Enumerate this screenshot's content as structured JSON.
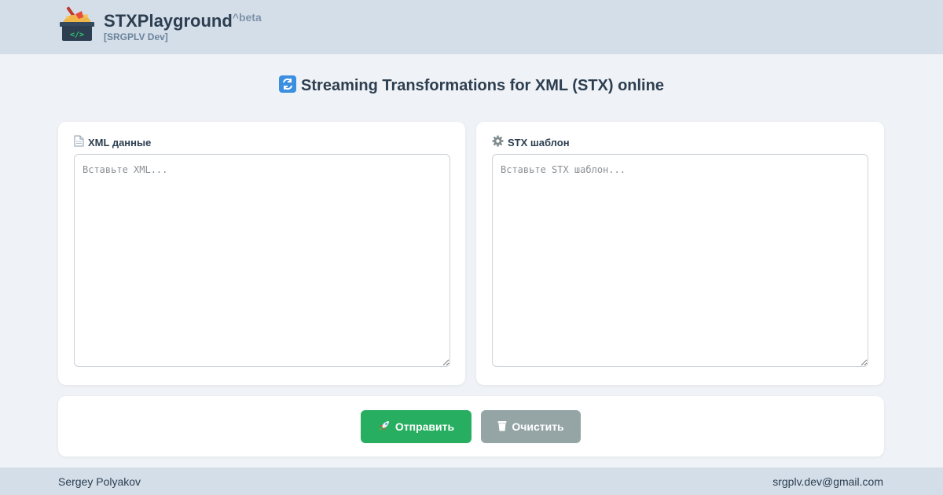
{
  "header": {
    "app_title": "STXPlayground",
    "beta_label": "^beta",
    "subtitle": "[SRGPLV Dev]",
    "logo_icon": "sandbox-code-icon"
  },
  "main": {
    "title": "Streaming Transformations for XML (STX) online",
    "title_icon": "refresh-arrows-icon",
    "xml_panel": {
      "label": "XML данные",
      "icon": "document-icon",
      "value": "",
      "placeholder": "Вставьте XML..."
    },
    "stx_panel": {
      "label": "STX шаблон",
      "icon": "gear-icon",
      "value": "",
      "placeholder": "Вставьте STX шаблон..."
    },
    "actions": {
      "send_label": "Отправить",
      "send_icon": "rocket-icon",
      "clear_label": "Очистить",
      "clear_icon": "trash-icon"
    }
  },
  "footer": {
    "author": "Sergey Polyakov",
    "email": "srgplv.dev@gmail.com"
  },
  "colors": {
    "header_bg": "#d3dee9",
    "page_bg": "#eff2f6",
    "send_button": "#27ae60",
    "clear_button": "#95a5a6",
    "text": "#2c3e50"
  }
}
